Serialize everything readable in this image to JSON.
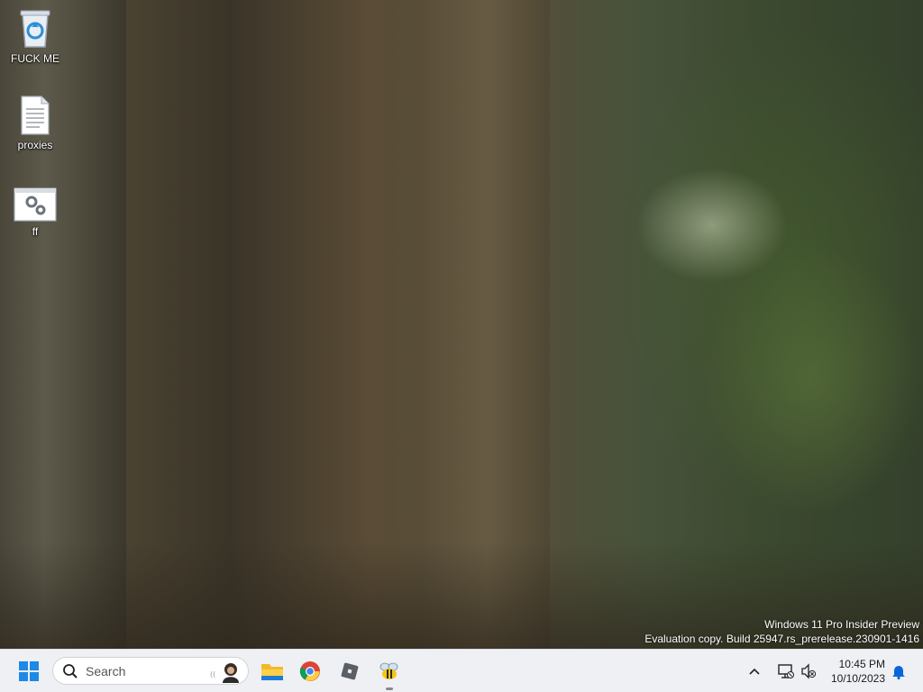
{
  "desktop": {
    "icons": [
      {
        "label": "FUCK ME",
        "icon": "recycle-bin-icon"
      },
      {
        "label": "proxies",
        "icon": "text-file-icon"
      },
      {
        "label": "ff",
        "icon": "settings-file-icon"
      }
    ]
  },
  "watermark": {
    "line1": "Windows 11 Pro Insider Preview",
    "line2": "Evaluation copy. Build 25947.rs_prerelease.230901-1416"
  },
  "taskbar": {
    "search_placeholder": "Search",
    "apps": [
      "file-explorer-icon",
      "chrome-icon",
      "roblox-icon",
      "bee-app-icon"
    ],
    "tray": {
      "time": "10:45 PM",
      "date": "10/10/2023"
    }
  },
  "colors": {
    "taskbar_bg": "#eef0f4",
    "windows_blue": "#0a66d8",
    "notification_blue": "#0a66d8"
  }
}
